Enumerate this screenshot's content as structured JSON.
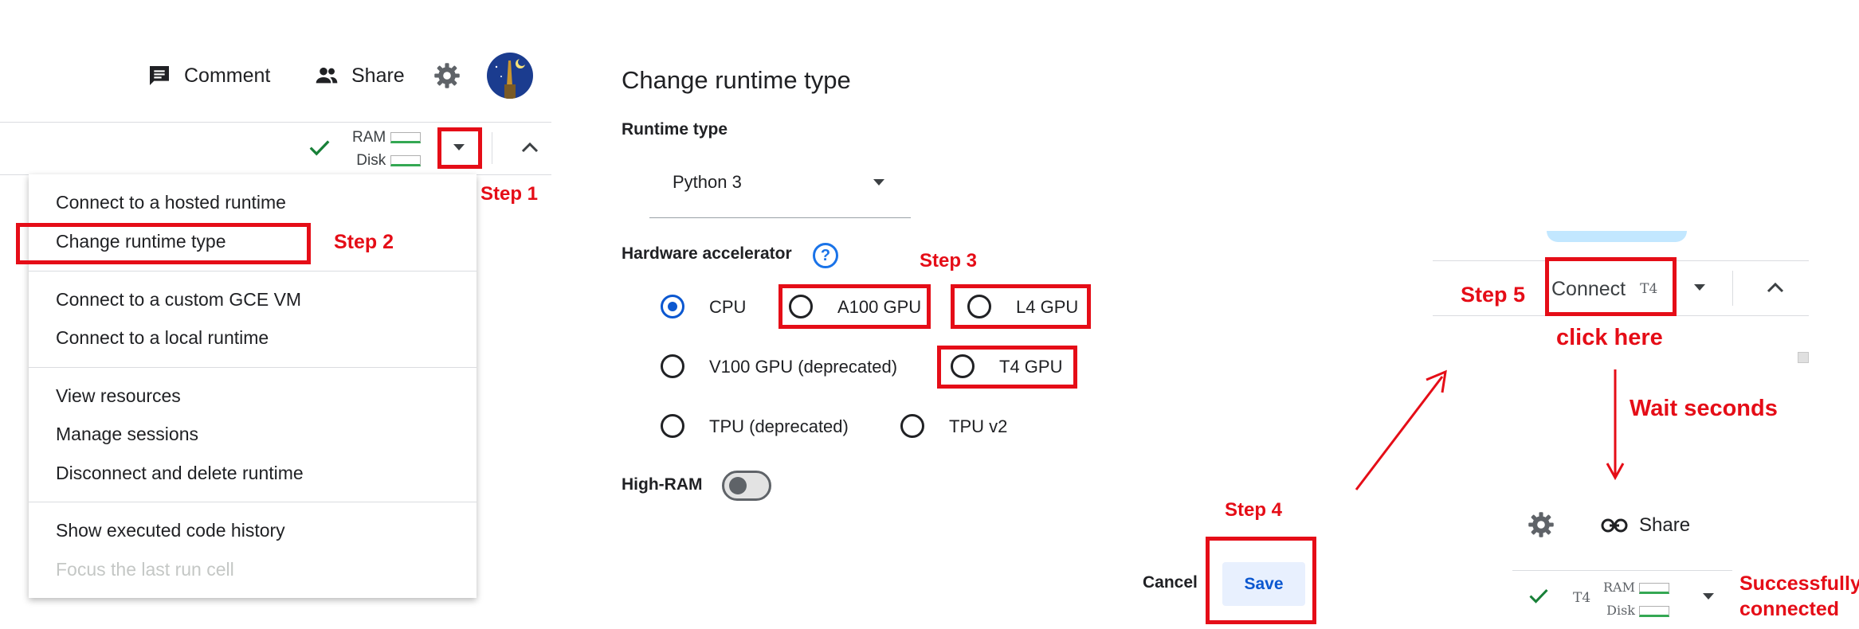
{
  "header": {
    "comment_label": "Comment",
    "share_label": "Share"
  },
  "resources": {
    "ram_label": "RAM",
    "disk_label": "Disk"
  },
  "runtime_menu": {
    "groups": [
      [
        "Connect to a hosted runtime",
        "Change runtime type"
      ],
      [
        "Connect to a custom GCE VM",
        "Connect to a local runtime"
      ],
      [
        "View resources",
        "Manage sessions",
        "Disconnect and delete runtime"
      ],
      [
        "Show executed code history",
        "Focus the last run cell"
      ]
    ]
  },
  "dialog": {
    "title": "Change runtime type",
    "runtime_type_label": "Runtime type",
    "runtime_type_value": "Python 3",
    "hardware_label": "Hardware accelerator",
    "help_glyph": "?",
    "options": [
      "CPU",
      "A100 GPU",
      "L4 GPU",
      "V100 GPU (deprecated)",
      "T4 GPU",
      "TPU (deprecated)",
      "TPU v2"
    ],
    "selected_option": "CPU",
    "high_ram_label": "High-RAM",
    "high_ram_on": false,
    "cancel_label": "Cancel",
    "save_label": "Save"
  },
  "connect_bar": {
    "connect_label": "Connect",
    "accelerator_tag": "T4"
  },
  "connected_bar": {
    "share_label": "Share",
    "accelerator_tag": "T4",
    "ram_label": "RAM",
    "disk_label": "Disk"
  },
  "annotations": {
    "step1": "Step 1",
    "step2": "Step 2",
    "step3": "Step 3",
    "step4": "Step 4",
    "step5": "Step 5",
    "click_here": "click here",
    "wait": "Wait seconds",
    "success_line1": "Successfully",
    "success_line2": "connected"
  },
  "colors": {
    "annotation_red": "#e50d17",
    "primary_blue": "#1a73e8",
    "save_bg": "#e8f0fe",
    "check_green": "#188038"
  },
  "icons": [
    "comment-icon",
    "people-icon",
    "gear-icon",
    "avatar",
    "check-icon",
    "dropdown-caret-icon",
    "chevron-up-icon",
    "help-icon",
    "link-icon"
  ]
}
